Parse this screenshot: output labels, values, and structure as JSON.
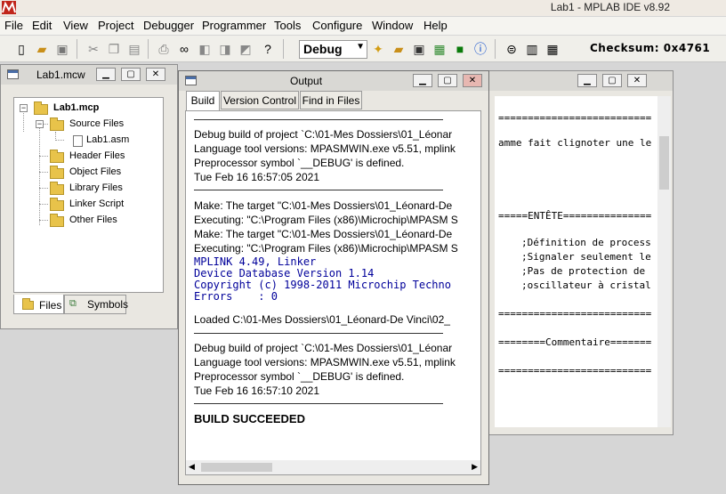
{
  "app": {
    "title": "Lab1 - MPLAB IDE v8.92"
  },
  "menu": [
    "File",
    "Edit",
    "View",
    "Project",
    "Debugger",
    "Programmer",
    "Tools",
    "Configure",
    "Window",
    "Help"
  ],
  "toolbar": {
    "configuration": "Debug",
    "checksum": "Checksum:  0x4761"
  },
  "workspace": {
    "title": "Lab1.mcw",
    "tree": {
      "project": "Lab1.mcp",
      "source_files": "Source Files",
      "source_file_1": "Lab1.asm",
      "header_files": "Header Files",
      "object_files": "Object Files",
      "library_files": "Library Files",
      "linker_script": "Linker Script",
      "other_files": "Other Files"
    },
    "tabs": [
      "Files",
      "Symbols"
    ]
  },
  "output": {
    "title": "Output",
    "tabs": [
      "Build",
      "Version Control",
      "Find in Files"
    ],
    "lines": [
      "Debug build of project `C:\\01-Mes Dossiers\\01_Léonar",
      "Language tool versions: MPASMWIN.exe v5.51, mplink",
      "Preprocessor symbol `__DEBUG' is defined.",
      "Tue Feb 16 16:57:05 2021",
      "Make: The target \"C:\\01-Mes Dossiers\\01_Léonard-De",
      "Executing: \"C:\\Program Files (x86)\\Microchip\\MPASM S",
      "Make: The target \"C:\\01-Mes Dossiers\\01_Léonard-De",
      "Executing: \"C:\\Program Files (x86)\\Microchip\\MPASM S",
      "MPLINK 4.49, Linker",
      "Device Database Version 1.14",
      "Copyright (c) 1998-2011 Microchip Techno",
      "Errors    : 0",
      "Loaded C:\\01-Mes Dossiers\\01_Léonard-De Vinci\\02_",
      "Debug build of project `C:\\01-Mes Dossiers\\01_Léonar",
      "Language tool versions: MPASMWIN.exe v5.51, mplink",
      "Preprocessor symbol `__DEBUG' is defined.",
      "Tue Feb 16 16:57:10 2021",
      "BUILD SUCCEEDED"
    ]
  },
  "editor": {
    "lines": [
      "==========================",
      "amme fait clignoter une le",
      "=====ENTÊTE===============",
      ";Définition de process",
      ";Signaler seulement le",
      ";Pas de protection de",
      ";oscillateur à cristal",
      "==========================",
      "========Commentaire=======",
      "=========================="
    ]
  }
}
